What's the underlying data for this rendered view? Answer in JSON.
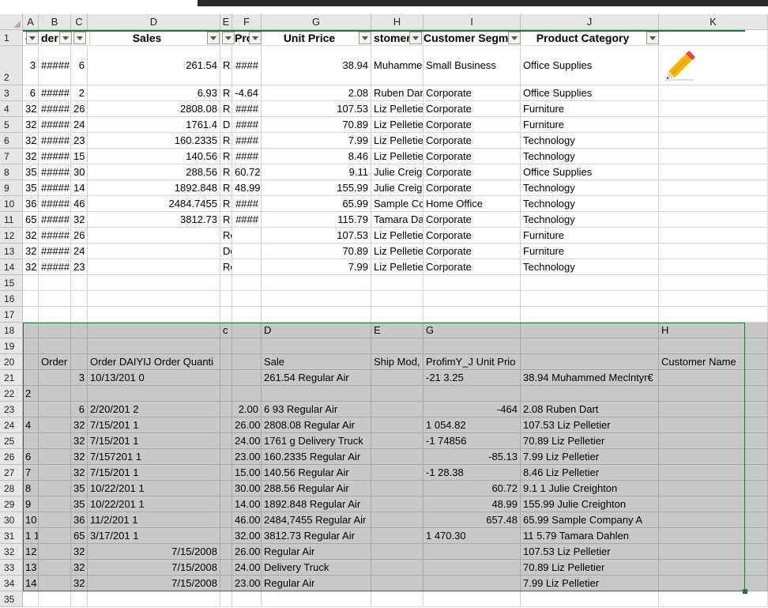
{
  "columns": [
    "A",
    "B",
    "C",
    "D",
    "E",
    "F",
    "G",
    "H",
    "I",
    "J",
    "K"
  ],
  "rows": [
    "1",
    "2",
    "3",
    "4",
    "5",
    "6",
    "7",
    "8",
    "9",
    "10",
    "11",
    "12",
    "13",
    "14",
    "15",
    "16",
    "17",
    "18",
    "19",
    "20",
    "21",
    "22",
    "23",
    "24",
    "25",
    "26",
    "27",
    "28",
    "29",
    "30",
    "31",
    "32",
    "33",
    "34",
    "35"
  ],
  "header_row": [
    "d",
    "der",
    "",
    "Sales",
    "",
    "Pro",
    "Unit Price",
    "stomer N",
    "Customer Segm",
    "Product Category",
    ""
  ],
  "filter_buttons": [
    "A",
    "B",
    "C",
    "D",
    "E",
    "F",
    "G",
    "H",
    "I",
    "J"
  ],
  "top_rows": [
    [
      "3",
      "#####",
      "6",
      "261.54",
      "R",
      "####",
      "38.94",
      "Muhamme",
      "Small Business",
      "Office Supplies",
      ""
    ],
    [
      "6",
      "#####",
      "2",
      "6.93",
      "R",
      "-4.64",
      "2.08",
      "Ruben Dar",
      "Corporate",
      "Office Supplies",
      ""
    ],
    [
      "32",
      "#####",
      "26",
      "2808.08",
      "R",
      "####",
      "107.53",
      "Liz Pelletie",
      "Corporate",
      "Furniture",
      ""
    ],
    [
      "32",
      "#####",
      "24",
      "1761.4",
      "D",
      "####",
      "70.89",
      "Liz Pelletie",
      "Corporate",
      "Furniture",
      ""
    ],
    [
      "32",
      "#####",
      "23",
      "160.2335",
      "R",
      "####",
      "7.99",
      "Liz Pelletie",
      "Corporate",
      "Technology",
      ""
    ],
    [
      "32",
      "#####",
      "15",
      "140.56",
      "R",
      "####",
      "8.46",
      "Liz Pelletie",
      "Corporate",
      "Technology",
      ""
    ],
    [
      "35",
      "#####",
      "30",
      "288.56",
      "R",
      "60.72",
      "9.11",
      "Julie Creig",
      "Corporate",
      "Office Supplies",
      ""
    ],
    [
      "35",
      "#####",
      "14",
      "1892.848",
      "R",
      "48.99",
      "155.99",
      "Julie Creig",
      "Corporate",
      "Technology",
      ""
    ],
    [
      "36",
      "#####",
      "46",
      "2484.7455",
      "R",
      "####",
      "65.99",
      "Sample Cc",
      "Home Office",
      "Technology",
      ""
    ],
    [
      "65",
      "#####",
      "32",
      "3812.73",
      "R",
      "####",
      "115.79",
      "Tamara Da",
      "Corporate",
      "Technology",
      ""
    ],
    [
      "32",
      "#####",
      "26",
      "",
      "Regular",
      "",
      "107.53",
      "Liz Pelletie",
      "Corporate",
      "Furniture",
      ""
    ],
    [
      "32",
      "#####",
      "24",
      "",
      "Delivery",
      "",
      "70.89",
      "Liz Pelletie",
      "Corporate",
      "Furniture",
      ""
    ],
    [
      "32",
      "#####",
      "23",
      "",
      "Regular",
      "",
      "7.99",
      "Liz Pelletie",
      "Corporate",
      "Technology",
      ""
    ]
  ],
  "pasted_rows": [
    [
      "",
      "",
      "",
      "",
      "c",
      "",
      "D",
      "E",
      "G",
      "",
      "H"
    ],
    [
      "",
      "",
      "",
      "",
      "",
      "",
      "",
      "",
      "",
      "",
      ""
    ],
    [
      "",
      "Order",
      "",
      "Order DAIYIJ Order Quanti",
      "",
      "",
      "Sale",
      "Ship Mod,",
      "ProfimY_J Unit Prio",
      "",
      "Customer Name"
    ],
    [
      "",
      "",
      "3",
      "10/13/201 0",
      "",
      "",
      "261.54 Regular Air",
      "",
      "-21 3.25",
      "38.94 Muhammed Meclntyr€",
      ""
    ],
    [
      "2",
      "",
      "",
      "",
      "",
      "",
      "",
      "",
      "",
      "",
      ""
    ],
    [
      "",
      "",
      "6",
      "2/20/201 2",
      "",
      "2.00",
      "6 93 Regular Air",
      "",
      "-464",
      "2.08 Ruben Dart",
      ""
    ],
    [
      "4",
      "",
      "32",
      "7/15/201 1",
      "",
      "26.00",
      "2808.08 Regular Air",
      "",
      "1 054.82",
      "107.53 Liz Pelletier",
      ""
    ],
    [
      "",
      "",
      "32",
      "7/15/201 1",
      "",
      "24.00",
      "1761 g Delivery Truck",
      "",
      "-1 74856",
      "70.89 Liz Pelletier",
      ""
    ],
    [
      "6",
      "",
      "32",
      "7/157201 1",
      "",
      "23.00",
      "160.2335 Regular Air",
      "",
      "-85.13",
      "7.99 Liz Pelletier",
      ""
    ],
    [
      "7",
      "",
      "32",
      "7/15/201 1",
      "",
      "15.00",
      "140.56 Regular Air",
      "",
      "-1 28.38",
      "8.46 Liz Pelletier",
      ""
    ],
    [
      "8",
      "",
      "35",
      "10/22/201 1",
      "",
      "30.00",
      "288.56 Regular Air",
      "",
      "60.72",
      "9.1 1 Julie Creighton",
      ""
    ],
    [
      "9",
      "",
      "35",
      "10/22/201 1",
      "",
      "14.00",
      "1892.848 Regular Air",
      "",
      "48.99",
      "155.99 Julie Creighton",
      ""
    ],
    [
      "10",
      "",
      "36",
      "11/2/201 1",
      "",
      "46.00",
      "2484,7455 Regular Air",
      "",
      "657.48",
      "65.99 Sample Company A",
      ""
    ],
    [
      "1 1",
      "",
      "65",
      "3/17/201 1",
      "",
      "32.00",
      "3812.73 Regular Air",
      "",
      "1 470.30",
      "11 5.79 Tamara Dahlen",
      ""
    ],
    [
      "12",
      "",
      "32",
      "7/15/2008",
      "",
      "26.00",
      "Regular Air",
      "",
      "",
      "107.53 Liz Pelletier",
      ""
    ],
    [
      "13",
      "",
      "32",
      "7/15/2008",
      "",
      "24.00",
      "Delivery Truck",
      "",
      "",
      "70.89 Liz Pelletier",
      ""
    ],
    [
      "14",
      "",
      "32",
      "7/15/2008",
      "",
      "23.00",
      "Regular Air",
      "",
      "",
      "7.99 Liz Pelletier",
      ""
    ]
  ],
  "icons": {
    "pencil": "pencil-icon",
    "select_all": "select-all-icon",
    "filter": "filter-dropdown-icon"
  },
  "colors": {
    "selection_border": "#217346",
    "selection_fill": "#c8c8c8",
    "header_bg": "#e6e6e6"
  }
}
